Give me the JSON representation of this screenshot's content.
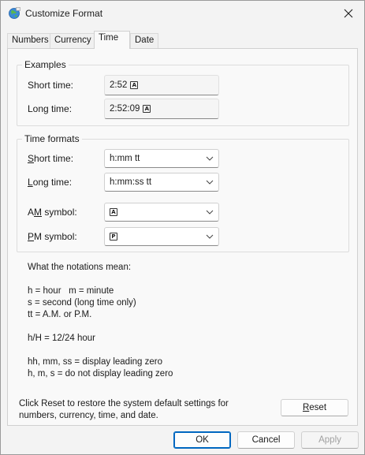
{
  "window": {
    "title": "Customize Format"
  },
  "icons": {
    "title": "regional-globe-icon",
    "close": "close-icon",
    "dropdown": "chevron-down-icon"
  },
  "tabs": [
    {
      "label": "Numbers"
    },
    {
      "label": "Currency"
    },
    {
      "label": "Time"
    },
    {
      "label": "Date"
    }
  ],
  "examples": {
    "legend": "Examples",
    "short_label": "Short time:",
    "short_value": "2:52",
    "long_label": "Long time:",
    "long_value": "2:52:09",
    "am_glyph": "A"
  },
  "formats": {
    "legend": "Time formats",
    "short_label_u": "S",
    "short_label_rest": "hort time:",
    "short_value": "h:mm tt",
    "long_label_u": "L",
    "long_label_rest": "ong time:",
    "long_value": "h:mm:ss tt",
    "am_label_pre": "A",
    "am_label_u": "M",
    "am_label_rest": " symbol:",
    "am_glyph": "A",
    "pm_label_u": "P",
    "pm_label_rest": "M symbol:",
    "pm_glyph": "P"
  },
  "notes": {
    "heading": "What the notations mean:",
    "line1": "h = hour   m = minute",
    "line2": "s = second (long time only)",
    "line3": "tt = A.M. or P.M.",
    "line4": "h/H = 12/24 hour",
    "line5": "hh, mm, ss = display leading zero",
    "line6": "h, m, s = do not display leading zero"
  },
  "reset": {
    "text_line1": "Click Reset to restore the system default settings for",
    "text_line2": "numbers, currency, time, and date.",
    "button_u": "R",
    "button_rest": "eset"
  },
  "footer": {
    "ok": "OK",
    "cancel": "Cancel",
    "apply": "Apply"
  }
}
